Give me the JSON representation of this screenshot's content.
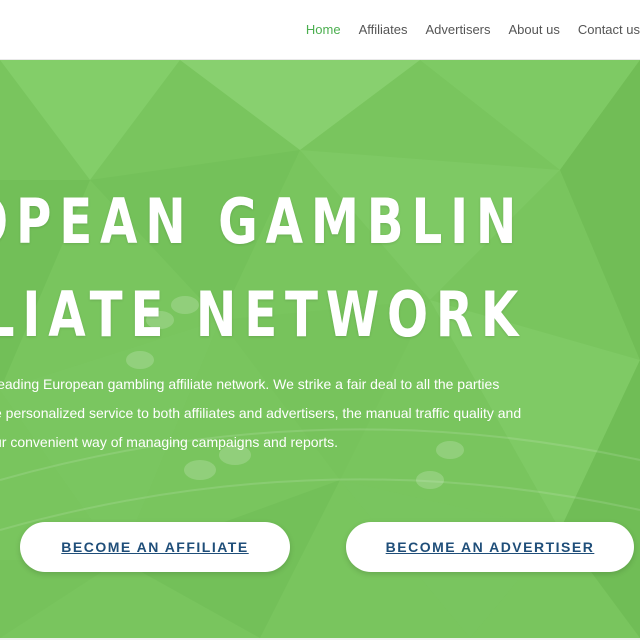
{
  "nav": {
    "items": [
      {
        "label": "Home",
        "active": true
      },
      {
        "label": "Affiliates",
        "active": false
      },
      {
        "label": "Advertisers",
        "active": false
      },
      {
        "label": "About us",
        "active": false
      },
      {
        "label": "Contact us",
        "active": false
      }
    ]
  },
  "hero": {
    "headline_line1": "ROPEAN GAMBLIN",
    "headline_line2": "ILIATE NETWORK",
    "intro_line1": "leading European gambling affiliate network. We strike a fair deal to all the parties",
    "intro_line2": "e personalized service to both affiliates and advertisers, the manual traffic quality and",
    "intro_line3": "ur convenient way of managing campaigns and reports.",
    "background_color": "#79c55e",
    "text_color": "#ffffff"
  },
  "cta": {
    "affiliate_label": "BECOME AN AFFILIATE",
    "advertiser_label": "BECOME AN ADVERTISER",
    "text_color": "#1f4e79",
    "button_bg": "#ffffff"
  },
  "colors": {
    "nav_active": "#4caf50",
    "nav_text": "#555555"
  }
}
